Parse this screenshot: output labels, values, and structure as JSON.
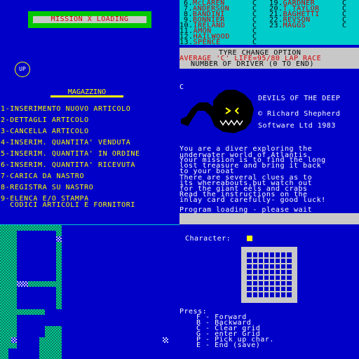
{
  "q1": {
    "mission_title": "MISSION X LOADING",
    "up_label": "UP",
    "menu_title": "MAGAZZINO",
    "menu_items": [
      "1-INSERIMENTO NUOVO ARTICOLO",
      "2-DETTAGLI ARTICOLO",
      "3-CANCELLA ARTICOLO",
      "4-INSERIM. QUANTITA' VENDUTA",
      "5-INSERIM. QUANTITA' IN ORDINE",
      "6-INSERIM. QUANTITA' RICEVUTA",
      "7-CARICA DA NASTRO",
      "8-REGISTRA SU NASTRO",
      "9-ELENCA E/O STAMPA",
      "  CODICI ARTICOLI E FORNITORI"
    ]
  },
  "q2": {
    "drivers_left": [
      {
        "num": "6.",
        "name": "McLAREN",
        "type": "C"
      },
      {
        "num": "7.",
        "name": "ANDERSON",
        "type": "C"
      },
      {
        "num": "8.",
        "name": "BANDINI",
        "type": "C"
      },
      {
        "num": "9.",
        "name": "BONNIER",
        "type": "C"
      },
      {
        "num": "10.",
        "name": "IRELAND",
        "type": "C"
      },
      {
        "num": "11.",
        "name": "AMON",
        "type": "C"
      },
      {
        "num": "12.",
        "name": "HAILWOOD",
        "type": "C"
      },
      {
        "num": "13.",
        "name": "SPENCE",
        "type": "C"
      }
    ],
    "drivers_right": [
      {
        "num": "19.",
        "name": "GARDNER",
        "type": "C"
      },
      {
        "num": "20.",
        "name": "T.TAYLOR",
        "type": "C"
      },
      {
        "num": "21.",
        "name": "BAGHETTI",
        "type": "C"
      },
      {
        "num": "22.",
        "name": "REVSON",
        "type": "C"
      },
      {
        "num": "23.",
        "name": "MAGGS",
        "type": "C"
      }
    ],
    "tyre_title": "TYRE CHANGE OPTION",
    "tyre_average": "AVERAGE 'C' LIFE=95/80 LAP RACE",
    "tyre_prompt": "NUMBER OF DRIVER (0 TO END)",
    "game_letter": "C",
    "game_title": "DEVILS OF THE DEEP",
    "copyright_1": "© Richard Shepherd",
    "copyright_2": "Software Ltd 1983",
    "story": [
      "You are a diver exploring the",
      "underwater world of Atlantis",
      "Your mission is to find the long",
      "lost treasure and bring it back",
      "to your boat",
      "There are several clues as to",
      "its whereabouts,but watch out",
      "for the giant eels and crabs",
      "Read the instructions on the",
      "inlay card carefully- good luck!"
    ],
    "loading_text": "Program loading - please wait"
  },
  "q4": {
    "character_label": "Character:",
    "press_label": "Press:",
    "keys": [
      "F - Forward",
      "B - Backward",
      "C - Clear grid",
      "G - enter Grid",
      "P - Pick up char.",
      "E - End (save)"
    ]
  },
  "colors": {
    "background": "#0000c8",
    "yellow": "#ffff00",
    "cyan": "#00cccc",
    "red": "#d00000",
    "green": "#00c800",
    "grey": "#c8c8c8"
  }
}
